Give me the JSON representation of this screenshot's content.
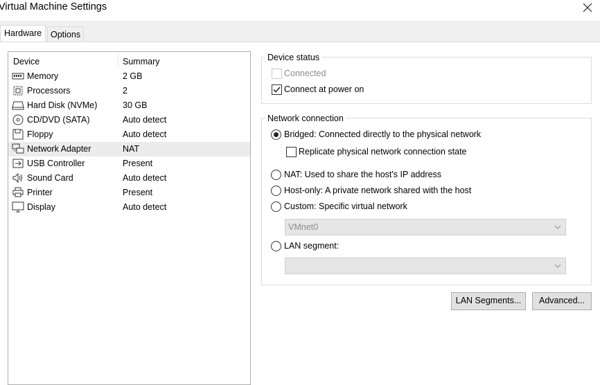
{
  "window": {
    "title": "Virtual Machine Settings"
  },
  "tabs": [
    {
      "label": "Hardware"
    },
    {
      "label": "Options"
    }
  ],
  "device_list": {
    "columns": {
      "device": "Device",
      "summary": "Summary"
    },
    "rows": [
      {
        "name": "Memory",
        "summary": "2 GB",
        "icon": "memory-icon"
      },
      {
        "name": "Processors",
        "summary": "2",
        "icon": "processor-icon"
      },
      {
        "name": "Hard Disk (NVMe)",
        "summary": "30 GB",
        "icon": "hard-disk-icon"
      },
      {
        "name": "CD/DVD (SATA)",
        "summary": "Auto detect",
        "icon": "cd-dvd-icon"
      },
      {
        "name": "Floppy",
        "summary": "Auto detect",
        "icon": "floppy-icon"
      },
      {
        "name": "Network Adapter",
        "summary": "NAT",
        "icon": "network-adapter-icon",
        "selected": true
      },
      {
        "name": "USB Controller",
        "summary": "Present",
        "icon": "usb-icon"
      },
      {
        "name": "Sound Card",
        "summary": "Auto detect",
        "icon": "speaker-icon"
      },
      {
        "name": "Printer",
        "summary": "Present",
        "icon": "printer-icon"
      },
      {
        "name": "Display",
        "summary": "Auto detect",
        "icon": "display-icon"
      }
    ]
  },
  "device_status": {
    "title": "Device status",
    "connected": {
      "label": "Connected",
      "checked": false,
      "enabled": false
    },
    "connect_at_power_on": {
      "label": "Connect at power on",
      "checked": true,
      "enabled": true
    }
  },
  "network_connection": {
    "title": "Network connection",
    "bridged": {
      "label": "Bridged: Connected directly to the physical network",
      "selected": true
    },
    "replicate": {
      "label": "Replicate physical network connection state",
      "checked": false
    },
    "nat": {
      "label": "NAT: Used to share the host's IP address",
      "selected": false
    },
    "host_only": {
      "label": "Host-only: A private network shared with the host",
      "selected": false
    },
    "custom": {
      "label": "Custom: Specific virtual network",
      "selected": false
    },
    "custom_select": {
      "value": "VMnet0"
    },
    "lan_segment": {
      "label": "LAN segment:",
      "selected": false
    },
    "lan_select": {
      "value": ""
    }
  },
  "buttons": {
    "lan_segments": "LAN Segments...",
    "advanced": "Advanced..."
  }
}
